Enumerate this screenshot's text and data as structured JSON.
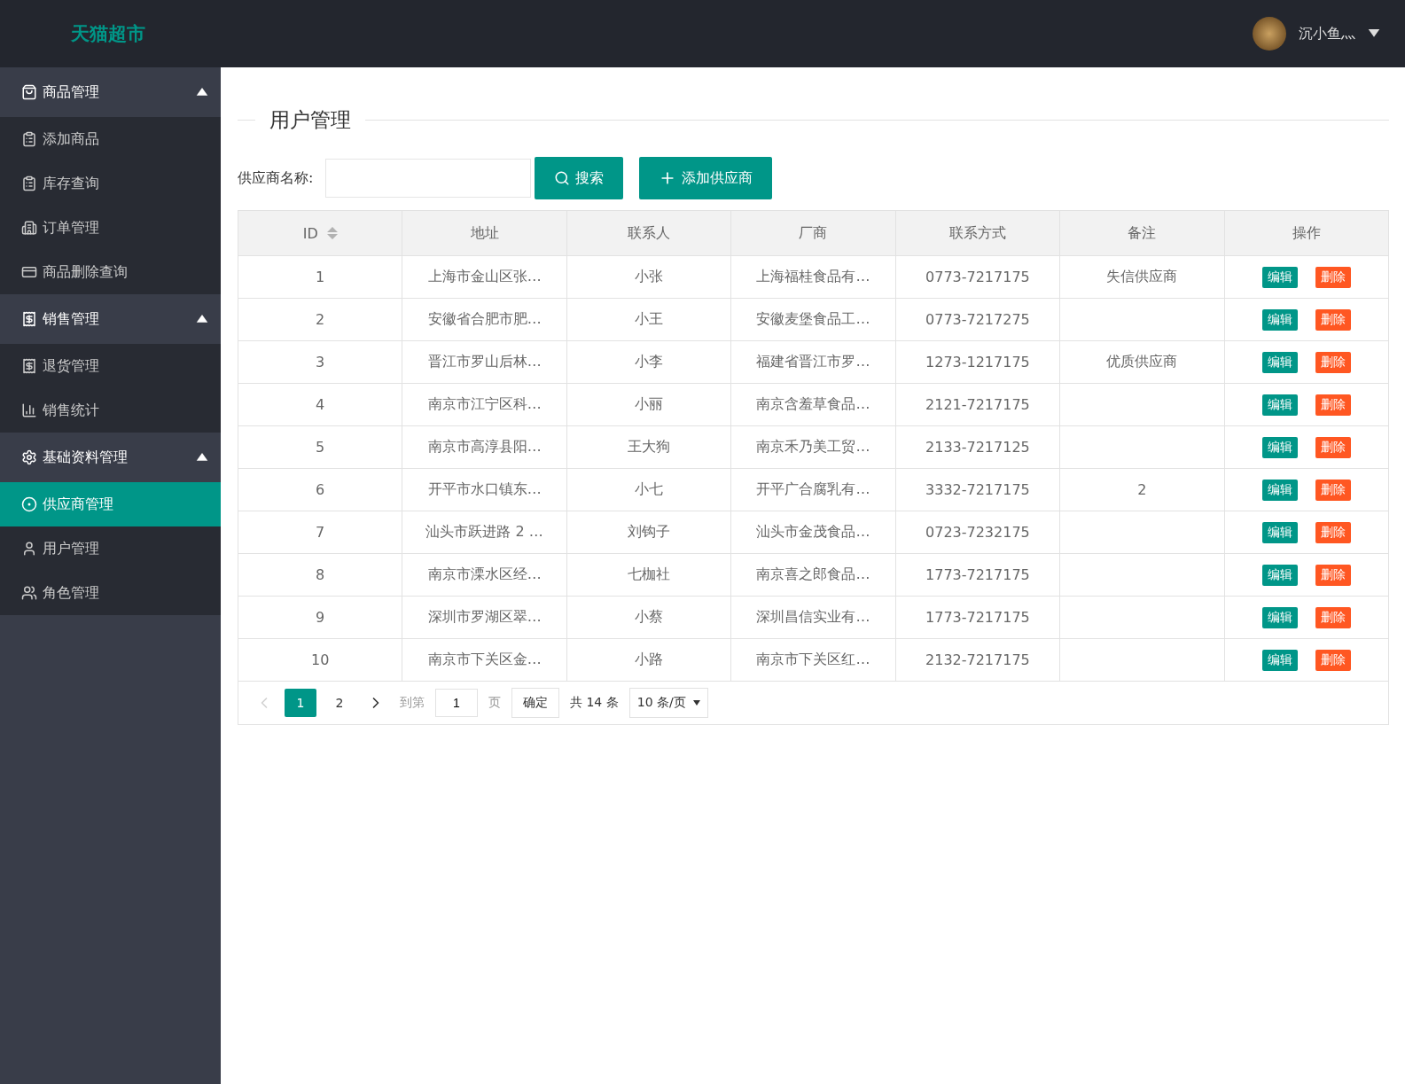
{
  "header": {
    "logo": "天猫超市",
    "user": {
      "name": "沉小鱼灬"
    }
  },
  "sidebar": {
    "groups": [
      {
        "label": "商品管理",
        "expanded": true,
        "items": [
          {
            "label": "添加商品",
            "selected": false
          },
          {
            "label": "库存查询",
            "selected": false
          },
          {
            "label": "订单管理",
            "selected": false
          },
          {
            "label": "商品删除查询",
            "selected": false
          }
        ]
      },
      {
        "label": "销售管理",
        "expanded": true,
        "items": [
          {
            "label": "退货管理",
            "selected": false
          },
          {
            "label": "销售统计",
            "selected": false
          }
        ]
      },
      {
        "label": "基础资料管理",
        "expanded": true,
        "items": [
          {
            "label": "供应商管理",
            "selected": true
          },
          {
            "label": "用户管理",
            "selected": false
          },
          {
            "label": "角色管理",
            "selected": false
          }
        ]
      }
    ]
  },
  "page_title": "用户管理",
  "search": {
    "label": "供应商名称:",
    "search_button": "搜索",
    "add_button": "添加供应商"
  },
  "table": {
    "columns": [
      {
        "label": "ID",
        "sortable": true
      },
      {
        "label": "地址",
        "sortable": false
      },
      {
        "label": "联系人",
        "sortable": false
      },
      {
        "label": "厂商",
        "sortable": false
      },
      {
        "label": "联系方式",
        "sortable": false
      },
      {
        "label": "备注",
        "sortable": false
      },
      {
        "label": "操作",
        "sortable": false
      }
    ],
    "rows": [
      {
        "cells": [
          "1",
          "上海市金山区张…",
          "小张",
          "上海福桂食品有…",
          "0773-7217175",
          "失信供应商"
        ],
        "actions": [
          "编辑",
          "删除"
        ]
      },
      {
        "cells": [
          "2",
          "安徽省合肥市肥…",
          "小王",
          "安徽麦堡食品工…",
          "0773-7217275",
          ""
        ],
        "actions": [
          "编辑",
          "删除"
        ]
      },
      {
        "cells": [
          "3",
          "晋江市罗山后林…",
          "小李",
          "福建省晋江市罗…",
          "1273-1217175",
          "优质供应商"
        ],
        "actions": [
          "编辑",
          "删除"
        ]
      },
      {
        "cells": [
          "4",
          "南京市江宁区科…",
          "小丽",
          "南京含羞草食品…",
          "2121-7217175",
          ""
        ],
        "actions": [
          "编辑",
          "删除"
        ]
      },
      {
        "cells": [
          "5",
          "南京市高淳县阳…",
          "王大狗",
          "南京禾乃美工贸…",
          "2133-7217125",
          ""
        ],
        "actions": [
          "编辑",
          "删除"
        ]
      },
      {
        "cells": [
          "6",
          "开平市水口镇东…",
          "小七",
          "开平广合腐乳有…",
          "3332-7217175",
          "2"
        ],
        "actions": [
          "编辑",
          "删除"
        ]
      },
      {
        "cells": [
          "7",
          "汕头市跃进路 2 …",
          "刘钩子",
          "汕头市金茂食品…",
          "0723-7232175",
          ""
        ],
        "actions": [
          "编辑",
          "删除"
        ]
      },
      {
        "cells": [
          "8",
          "南京市溧水区经…",
          "七枷社",
          "南京喜之郎食品…",
          "1773-7217175",
          ""
        ],
        "actions": [
          "编辑",
          "删除"
        ]
      },
      {
        "cells": [
          "9",
          "深圳市罗湖区翠…",
          "小蔡",
          "深圳昌信实业有…",
          "1773-7217175",
          ""
        ],
        "actions": [
          "编辑",
          "删除"
        ]
      },
      {
        "cells": [
          "10",
          "南京市下关区金…",
          "小路",
          "南京市下关区红…",
          "2132-7217175",
          ""
        ],
        "actions": [
          "编辑",
          "删除"
        ]
      }
    ]
  },
  "pagination": {
    "prev_disabled": true,
    "pages": [
      {
        "label": "1",
        "selected": true
      },
      {
        "label": "2",
        "selected": false
      }
    ],
    "goto_label": "到第",
    "goto_value": "1",
    "page_unit": "页",
    "confirm": "确定",
    "total": "共 14 条",
    "page_size": "10 条/页"
  }
}
